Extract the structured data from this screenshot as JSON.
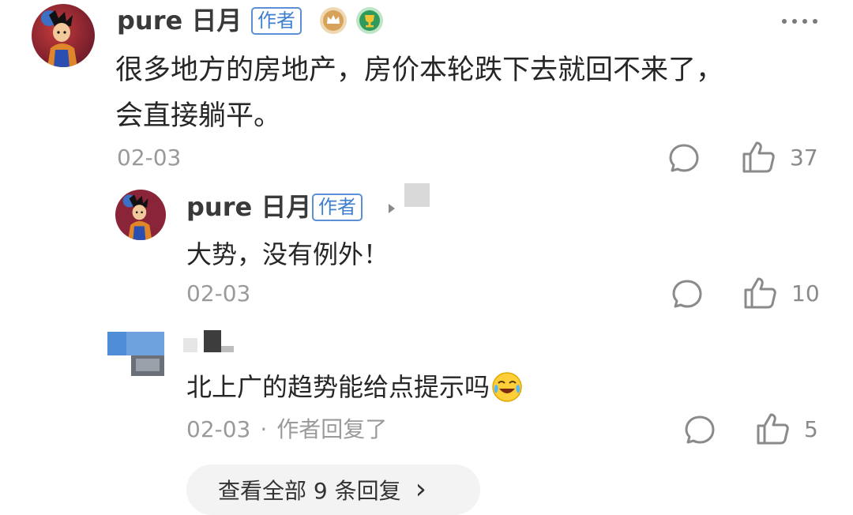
{
  "comment": {
    "username": "pure 日月",
    "author_tag": "作者",
    "text_line1": "很多地方的房地产，房价本轮跌下去就回不来了，",
    "text_line2": "会直接躺平。",
    "date": "02-03",
    "like_count": "37"
  },
  "replies": [
    {
      "username": "pure 日月",
      "author_tag": "作者",
      "text": "大势，没有例外！",
      "date": "02-03",
      "like_count": "10"
    },
    {
      "text": "北上广的趋势能给点提示吗",
      "date": "02-03",
      "separator": "·",
      "status": "作者回复了",
      "like_count": "5"
    }
  ],
  "view_all": {
    "label": "查看全部 9 条回复",
    "chevron": "›"
  },
  "icons": {
    "avatar": "anime-avatar",
    "level_badge": "crown-badge",
    "achievement_badge": "trophy-badge",
    "comment": "comment-bubble-icon",
    "like": "thumbs-up-icon",
    "more": "more-dots-icon",
    "emoji": "laughing-tears-emoji"
  },
  "colors": {
    "author_tag": "#3f7fd0",
    "meta": "#9a9a9a",
    "view_all_bg": "#f3f3f3"
  }
}
